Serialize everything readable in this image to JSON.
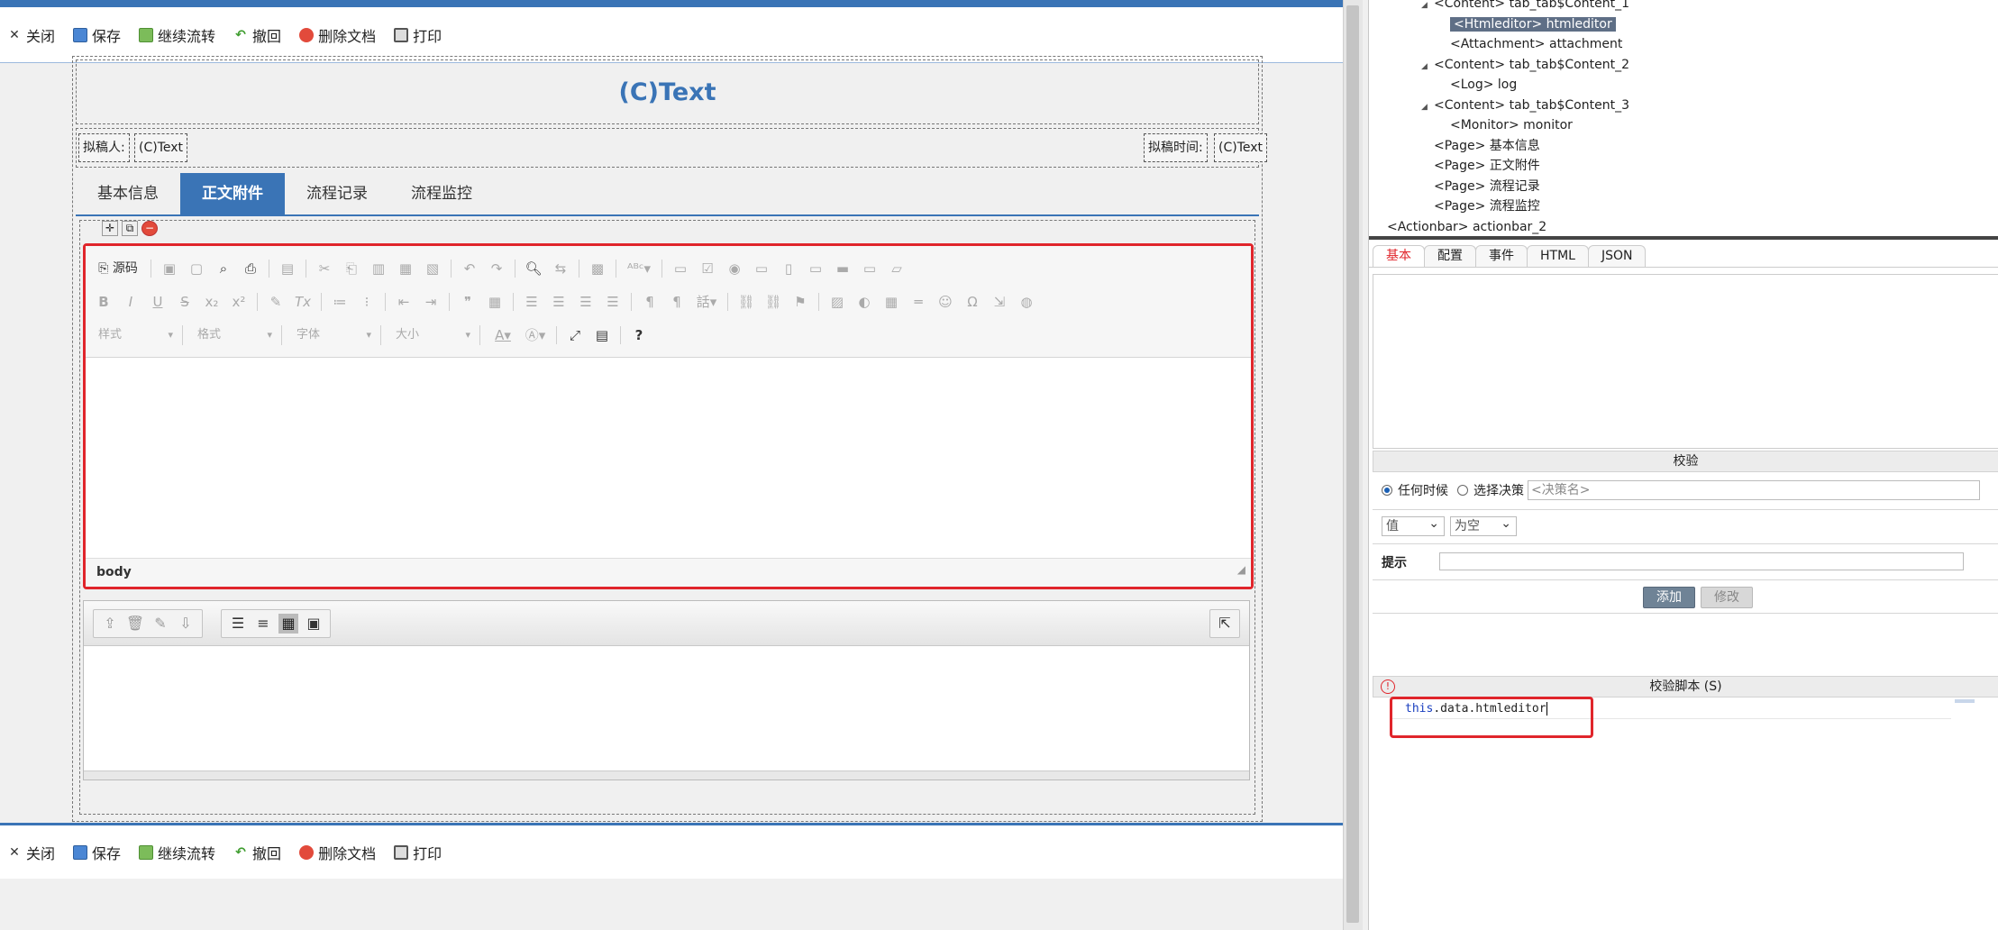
{
  "toolbar": {
    "close": "关闭",
    "save": "保存",
    "continue_flow": "继续流转",
    "retract": "撤回",
    "delete_doc": "删除文档",
    "print": "打印"
  },
  "form": {
    "title": "(C)Text",
    "drafter_label": "拟稿人:",
    "drafter_value": "(C)Text",
    "draft_time_label": "拟稿时间:",
    "draft_time_value": "(C)Text",
    "tabs": [
      "基本信息",
      "正文附件",
      "流程记录",
      "流程监控"
    ],
    "active_tab": 1
  },
  "editor": {
    "source_label": "源码",
    "combo_style": "样式",
    "combo_format": "格式",
    "combo_font": "字体",
    "combo_size": "大小",
    "status_path": "body"
  },
  "tree": {
    "items": [
      {
        "label": "<Content> tab_tab$Content_1",
        "indent": 2,
        "expand": true
      },
      {
        "label": "<Htmleditor> htmleditor",
        "indent": 3,
        "selected": true
      },
      {
        "label": "<Attachment> attachment",
        "indent": 3
      },
      {
        "label": "<Content> tab_tab$Content_2",
        "indent": 2,
        "expand": true
      },
      {
        "label": "<Log> log",
        "indent": 3
      },
      {
        "label": "<Content> tab_tab$Content_3",
        "indent": 2,
        "expand": true
      },
      {
        "label": "<Monitor> monitor",
        "indent": 3
      },
      {
        "label": "<Page> 基本信息",
        "indent": 2
      },
      {
        "label": "<Page> 正文附件",
        "indent": 2
      },
      {
        "label": "<Page> 流程记录",
        "indent": 2
      },
      {
        "label": "<Page> 流程监控",
        "indent": 2
      },
      {
        "label": "<Actionbar> actionbar_2",
        "indent": 1
      }
    ]
  },
  "props": {
    "tabs": [
      "基本",
      "配置",
      "事件",
      "HTML",
      "JSON"
    ],
    "active_tab": 0,
    "validation_header": "校验",
    "radio_anytime": "任何时候",
    "radio_choose": "选择决策",
    "decision_placeholder": "<决策名>",
    "select_value": "值",
    "select_empty": "为空",
    "hint_label": "提示",
    "add_button": "添加",
    "modify_button": "修改",
    "script_header": "校验脚本 (S)",
    "script_kw": "this",
    "script_rest": ".data.htmleditor"
  }
}
